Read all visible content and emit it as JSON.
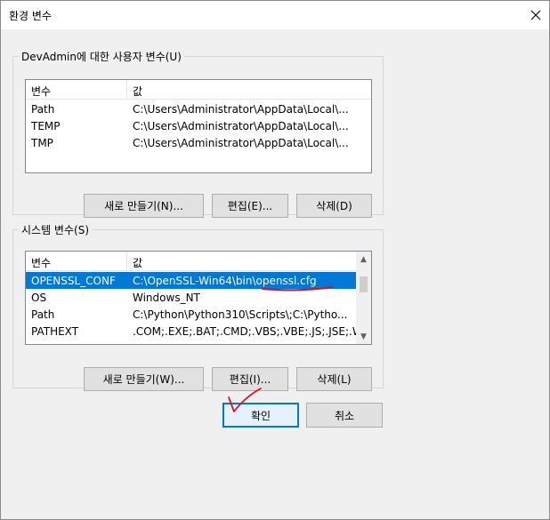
{
  "window": {
    "title": "환경 변수"
  },
  "user_vars": {
    "legend": "DevAdmin에 대한 사용자 변수(U)",
    "columns": [
      "변수",
      "값"
    ],
    "rows": [
      {
        "name": "Path",
        "value": "C:\\Users\\Administrator\\AppData\\Local\\..."
      },
      {
        "name": "TEMP",
        "value": "C:\\Users\\Administrator\\AppData\\Local\\..."
      },
      {
        "name": "TMP",
        "value": "C:\\Users\\Administrator\\AppData\\Local\\..."
      }
    ],
    "buttons": {
      "new": "새로 만들기(N)...",
      "edit": "편집(E)...",
      "delete": "삭제(D)"
    }
  },
  "system_vars": {
    "legend": "시스템 변수(S)",
    "columns": [
      "변수",
      "값"
    ],
    "rows": [
      {
        "name": "OPENSSL_CONF",
        "value": "C:\\OpenSSL-Win64\\bin\\openssl.cfg"
      },
      {
        "name": "OS",
        "value": "Windows_NT"
      },
      {
        "name": "Path",
        "value": "C:\\Python\\Python310\\Scripts\\;C:\\Pytho..."
      },
      {
        "name": "PATHEXT",
        "value": ".COM;.EXE;.BAT;.CMD;.VBS;.VBE;.JS;.JSE;.W..."
      }
    ],
    "selected_index": 0,
    "buttons": {
      "new": "새로 만들기(W)...",
      "edit": "편집(I)...",
      "delete": "삭제(L)"
    }
  },
  "footer": {
    "ok": "확인",
    "cancel": "취소"
  },
  "colors": {
    "selection": "#0078d7",
    "annotation_red": "#e01020"
  }
}
